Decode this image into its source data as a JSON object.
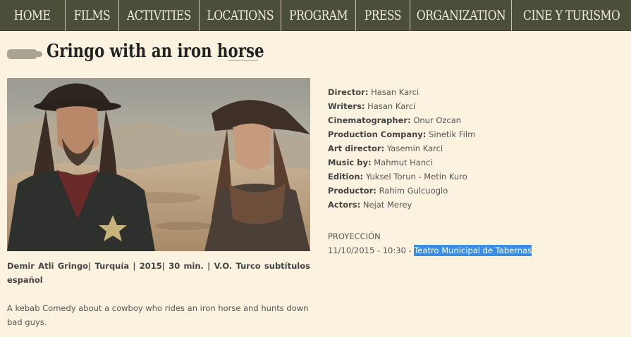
{
  "nav": {
    "items": [
      "HOME",
      "FILMS",
      "ACTIVITIES",
      "LOCATIONS",
      "PROGRAM",
      "PRESS",
      "ORGANIZATION",
      "CINE Y TURISMO"
    ]
  },
  "film": {
    "title": "Gringo with an iron horse",
    "credits_line": "Demir Atli Gringo| Turquía | 2015| 30 min. | V.O. Turco subtítulos español",
    "synopsis": "A kebab Comedy about a cowboy who rides an iron horse and hunts down bad guys."
  },
  "crew": [
    {
      "label": "Director:",
      "value": "Hasan Karci"
    },
    {
      "label": "Writers:",
      "value": "Hasan Karci"
    },
    {
      "label": "Cinematographer:",
      "value": "Onur Ozcan"
    },
    {
      "label": "Production Company:",
      "value": "Sinetik Film"
    },
    {
      "label": "Art director:",
      "value": "Yasemin Karci"
    },
    {
      "label": "Music by:",
      "value": "Mahmut Hanci"
    },
    {
      "label": "Edition:",
      "value": "Yuksel Torun - Metin Kuro"
    },
    {
      "label": "Productor:",
      "value": "Rahim Gulcuoglo"
    },
    {
      "label": "Actors:",
      "value": "Nejat Merey"
    }
  ],
  "projection": {
    "label": "PROYECCIÓN",
    "datetime": "11/10/2015 - 10:30 - ",
    "venue": "Teatro Municipal de Tabernas"
  },
  "colors": {
    "nav_bg": "#4b4e38",
    "page_bg": "#fbf3e0",
    "link_highlight": "#3a8ee6"
  }
}
